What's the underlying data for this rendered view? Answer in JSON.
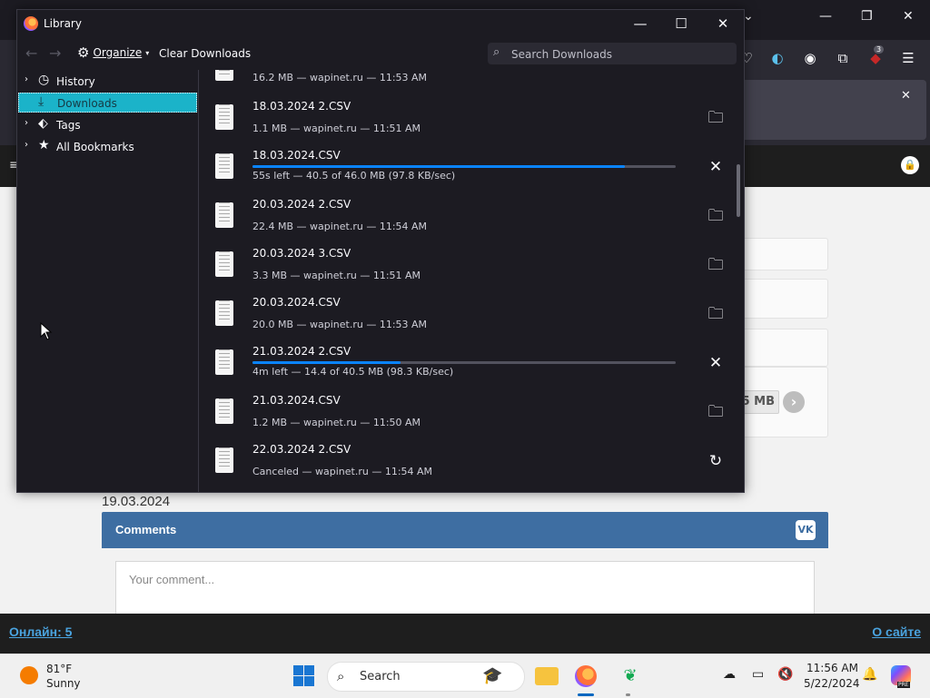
{
  "background_browser": {
    "toolbar_badge": "3",
    "size_chip": "5 MB",
    "date": "19.03.2024",
    "comments_title": "Comments",
    "vk_label": "VK",
    "comment_placeholder": "Your comment...",
    "footer_left": "Онлайн: 5",
    "footer_right": "О сайте"
  },
  "library": {
    "title": "Library",
    "toolbar": {
      "organize_label": "Organize",
      "clear_downloads_label": "Clear Downloads",
      "search_placeholder": "Search Downloads"
    },
    "sidebar": [
      {
        "label": "History",
        "icon": "clock-icon",
        "selected": false,
        "twisty": true
      },
      {
        "label": "Downloads",
        "icon": "download-icon",
        "selected": true,
        "twisty": false
      },
      {
        "label": "Tags",
        "icon": "tag-icon",
        "selected": false,
        "twisty": true
      },
      {
        "label": "All Bookmarks",
        "icon": "star-icon",
        "selected": false,
        "twisty": true
      }
    ],
    "partial_row_status": "16.2 MB — wapinet.ru — 11:53 AM",
    "downloads": [
      {
        "name": "18.03.2024 2.CSV",
        "status": "1.1 MB — wapinet.ru — 11:51 AM",
        "action": "folder",
        "progress": null
      },
      {
        "name": "18.03.2024.CSV",
        "status": "55s left — 40.5 of 46.0 MB (97.8 KB/sec)",
        "action": "cancel",
        "progress": 0.88
      },
      {
        "name": "20.03.2024 2.CSV",
        "status": "22.4 MB — wapinet.ru — 11:54 AM",
        "action": "folder",
        "progress": null
      },
      {
        "name": "20.03.2024 3.CSV",
        "status": "3.3 MB — wapinet.ru — 11:51 AM",
        "action": "folder",
        "progress": null
      },
      {
        "name": "20.03.2024.CSV",
        "status": "20.0 MB — wapinet.ru — 11:53 AM",
        "action": "folder",
        "progress": null
      },
      {
        "name": "21.03.2024 2.CSV",
        "status": "4m left — 14.4 of 40.5 MB (98.3 KB/sec)",
        "action": "cancel",
        "progress": 0.35
      },
      {
        "name": "21.03.2024.CSV",
        "status": "1.2 MB — wapinet.ru — 11:50 AM",
        "action": "folder",
        "progress": null
      },
      {
        "name": "22.03.2024 2.CSV",
        "status": "Canceled — wapinet.ru — 11:54 AM",
        "action": "retry",
        "progress": null
      }
    ]
  },
  "taskbar": {
    "weather_temp": "81°F",
    "weather_desc": "Sunny",
    "search_label": "Search",
    "time": "11:56 AM",
    "date": "5/22/2024",
    "copilot_badge": "PRE"
  }
}
